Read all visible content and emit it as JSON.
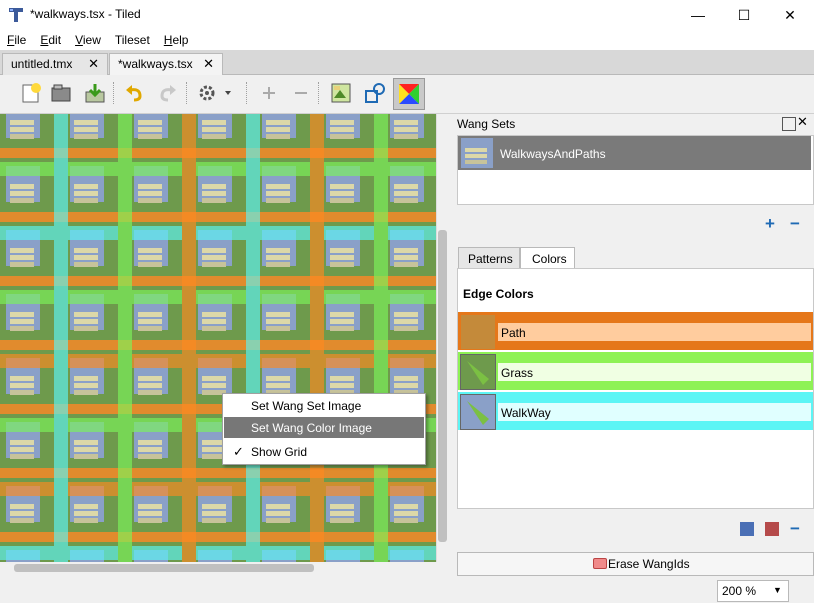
{
  "window": {
    "title": "*walkways.tsx - Tiled",
    "minimize": "—",
    "maximize": "☐",
    "close": "✕"
  },
  "menu": [
    "File",
    "Edit",
    "View",
    "Tileset",
    "Help"
  ],
  "menu_ul": [
    "F",
    "E",
    "V",
    "",
    "H"
  ],
  "menu_rest": [
    "ile",
    "dit",
    "iew",
    "Tileset",
    "elp"
  ],
  "tabs": [
    {
      "label": "untitled.tmx",
      "close": "✕"
    },
    {
      "label": "*walkways.tsx",
      "close": "✕"
    }
  ],
  "toolbar_icons": [
    "new-file-icon",
    "open-folder-icon",
    "save-icon",
    "undo-icon",
    "redo-icon",
    "gear-icon",
    "plus-icon",
    "minus-icon",
    "tileset-image-icon",
    "dynamic-wrapping-icon",
    "wang-color-icon"
  ],
  "context_menu": {
    "items": [
      "Set Wang Set Image",
      "Set Wang Color Image",
      "Show Grid"
    ],
    "check": "✓"
  },
  "wang_sets": {
    "header": "Wang Sets",
    "items": [
      {
        "name": "WalkwaysAndPaths"
      }
    ],
    "add": "+",
    "remove": "−"
  },
  "panel_tabs": [
    "Patterns",
    "Colors"
  ],
  "edge_colors": {
    "heading": "Edge Colors",
    "items": [
      {
        "name": "Path",
        "color": "#e5771a",
        "light": "#ffcc9e"
      },
      {
        "name": "Grass",
        "color": "#8ef255",
        "light": "#f0ffe3"
      },
      {
        "name": "WalkWay",
        "color": "#5cf5f5",
        "light": "#e0ffff"
      }
    ]
  },
  "erase_button": "Erase WangIds",
  "zoom": {
    "value": "200 %",
    "arrow": "▼"
  }
}
